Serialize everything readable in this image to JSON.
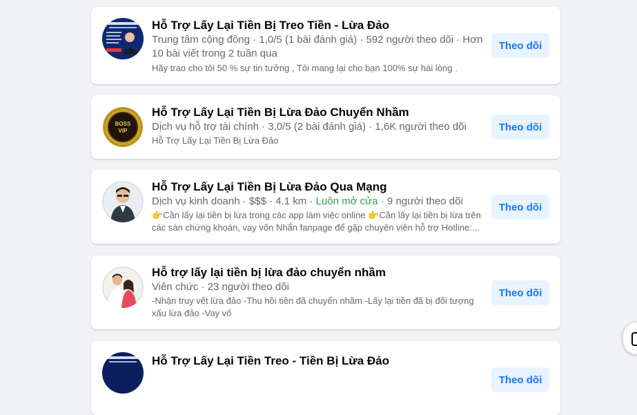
{
  "results": [
    {
      "title": "Hỗ Trợ Lấy Lại Tiền Bị Treo Tiền - Lừa Đảo",
      "meta_line1": "Trung tâm cộng đồng · 1,0/5 (1 bài đánh giá) · 592 người theo dõi · Hơn",
      "meta_line2": "10 bài viết trong 2 tuần qua",
      "desc_line1": "Hãy trao cho tôi 50 % sự tin tưởng , Tôi mang lại cho bạn 100% sự hài lòng .",
      "follow_label": "Theo dõi"
    },
    {
      "title": "Hỗ Trợ Lấy Lại Tiền Bị Lừa Đảo Chuyển Nhầm",
      "meta_line1": "Dịch vụ hỗ trợ tài chính · 3,0/5 (2 bài đánh giá) · 1,6K người theo dõi",
      "desc_line1": "Hỗ Trợ Lấy Lại Tiền Bị Lừa Đảo",
      "avatar_text_1": "BOSS",
      "avatar_text_2": "VIP",
      "follow_label": "Theo dõi"
    },
    {
      "title": "Hỗ Trợ Lấy Lại Tiền Bị Lừa Đảo Qua Mạng",
      "meta_prefix": "Dịch vụ kinh doanh · $$$ · 4.1 km · ",
      "meta_open": "Luôn mở cửa",
      "meta_suffix": " · 9 người theo dõi",
      "desc_line1_a": "Cần lấy lại tiền bị lừa trong các app làm việc online ",
      "desc_line1_b": "Cần lấy lại tiền bị lừa trên",
      "desc_line2": "các sàn chứng khoán, vay vốn Nhắn fanpage để gặp chuyên viên hỗ trợ Hotline:...",
      "hand_emoji": "👉",
      "follow_label": "Theo dõi"
    },
    {
      "title": "Hỗ trợ lấy lại tiền bị lừa đảo chuyển nhầm",
      "meta_line1": "Viên chức · 23 người theo dõi",
      "desc_line1": "-Nhận truy vết lừa đảo -Thu hồi tiền đã chuyển nhầm -Lấy lại tiền đã bị đối tượng",
      "desc_line2": "xấu lừa đảo -Vay vố",
      "follow_label": "Theo dõi"
    },
    {
      "title": "Hỗ Trợ Lấy Lại Tiền Treo - Tiền Bị Lừa Đảo",
      "follow_label": "Theo dõi"
    }
  ]
}
